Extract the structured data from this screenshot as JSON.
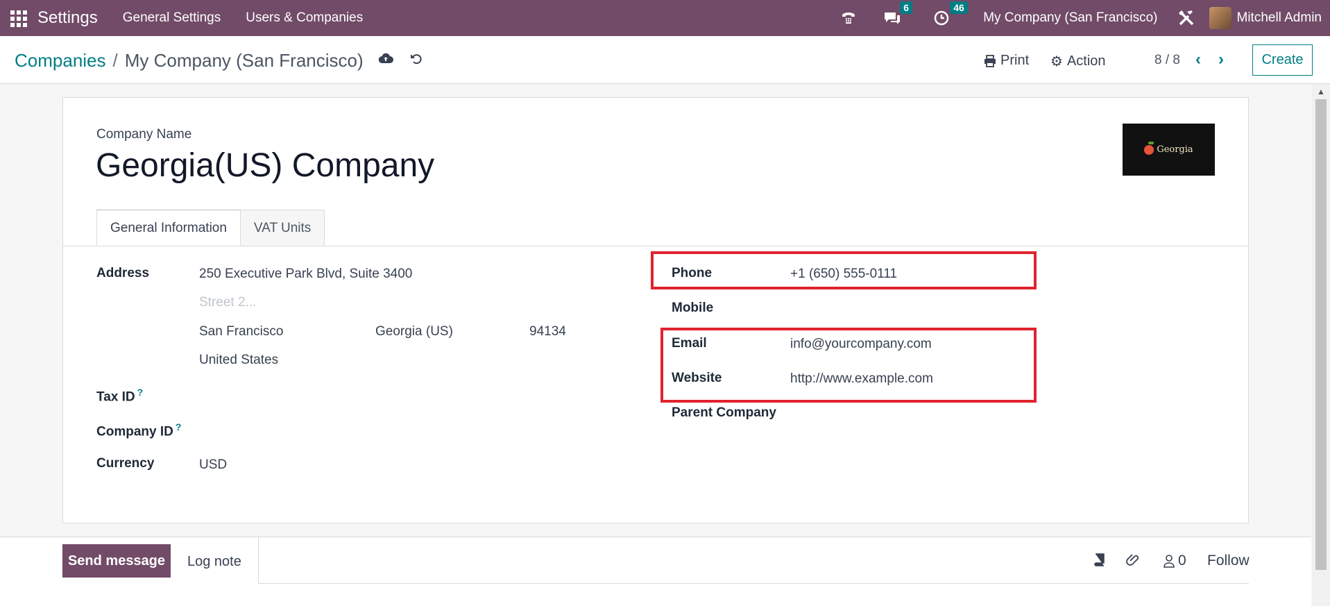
{
  "topbar": {
    "app_title": "Settings",
    "menu": [
      "General Settings",
      "Users & Companies"
    ],
    "chat_count": "6",
    "activity_count": "46",
    "company": "My Company (San Francisco)",
    "user_name": "Mitchell Admin"
  },
  "control_panel": {
    "breadcrumb_parent": "Companies",
    "breadcrumb_separator": "/",
    "breadcrumb_current": "My Company (San Francisco)",
    "print_label": "Print",
    "action_label": "Action",
    "pager_value": "8 / 8",
    "create_label": "Create"
  },
  "form": {
    "company_name_label": "Company Name",
    "company_name": "Georgia(US) Company",
    "logo_text": "Georgia",
    "tabs": [
      "General Information",
      "VAT Units"
    ],
    "address_label": "Address",
    "street": "250 Executive Park Blvd, Suite 3400",
    "street2_placeholder": "Street 2...",
    "city": "San Francisco",
    "state": "Georgia (US)",
    "zip": "94134",
    "country": "United States",
    "tax_id_label": "Tax ID",
    "company_id_label": "Company ID",
    "help_mark": "?",
    "currency_label": "Currency",
    "currency": "USD",
    "phone_label": "Phone",
    "phone": "+1 (650) 555-0111",
    "mobile_label": "Mobile",
    "email_label": "Email",
    "email": "info@yourcompany.com",
    "website_label": "Website",
    "website": "http://www.example.com",
    "parent_company_label": "Parent Company"
  },
  "chatter": {
    "send_message_label": "Send message",
    "log_note_label": "Log note",
    "followers_count": "0",
    "follow_label": "Follow"
  },
  "colors": {
    "brand": "#714b67",
    "accent": "#017e84",
    "highlight": "#e0232e"
  },
  "icons": [
    "apps-grid-icon",
    "phone-icon",
    "chat-icon",
    "clock-icon",
    "tools-icon",
    "cloud-upload-icon",
    "undo-icon",
    "print-icon",
    "gear-icon",
    "chevron-left-icon",
    "chevron-right-icon",
    "book-icon",
    "paperclip-icon",
    "user-icon"
  ]
}
